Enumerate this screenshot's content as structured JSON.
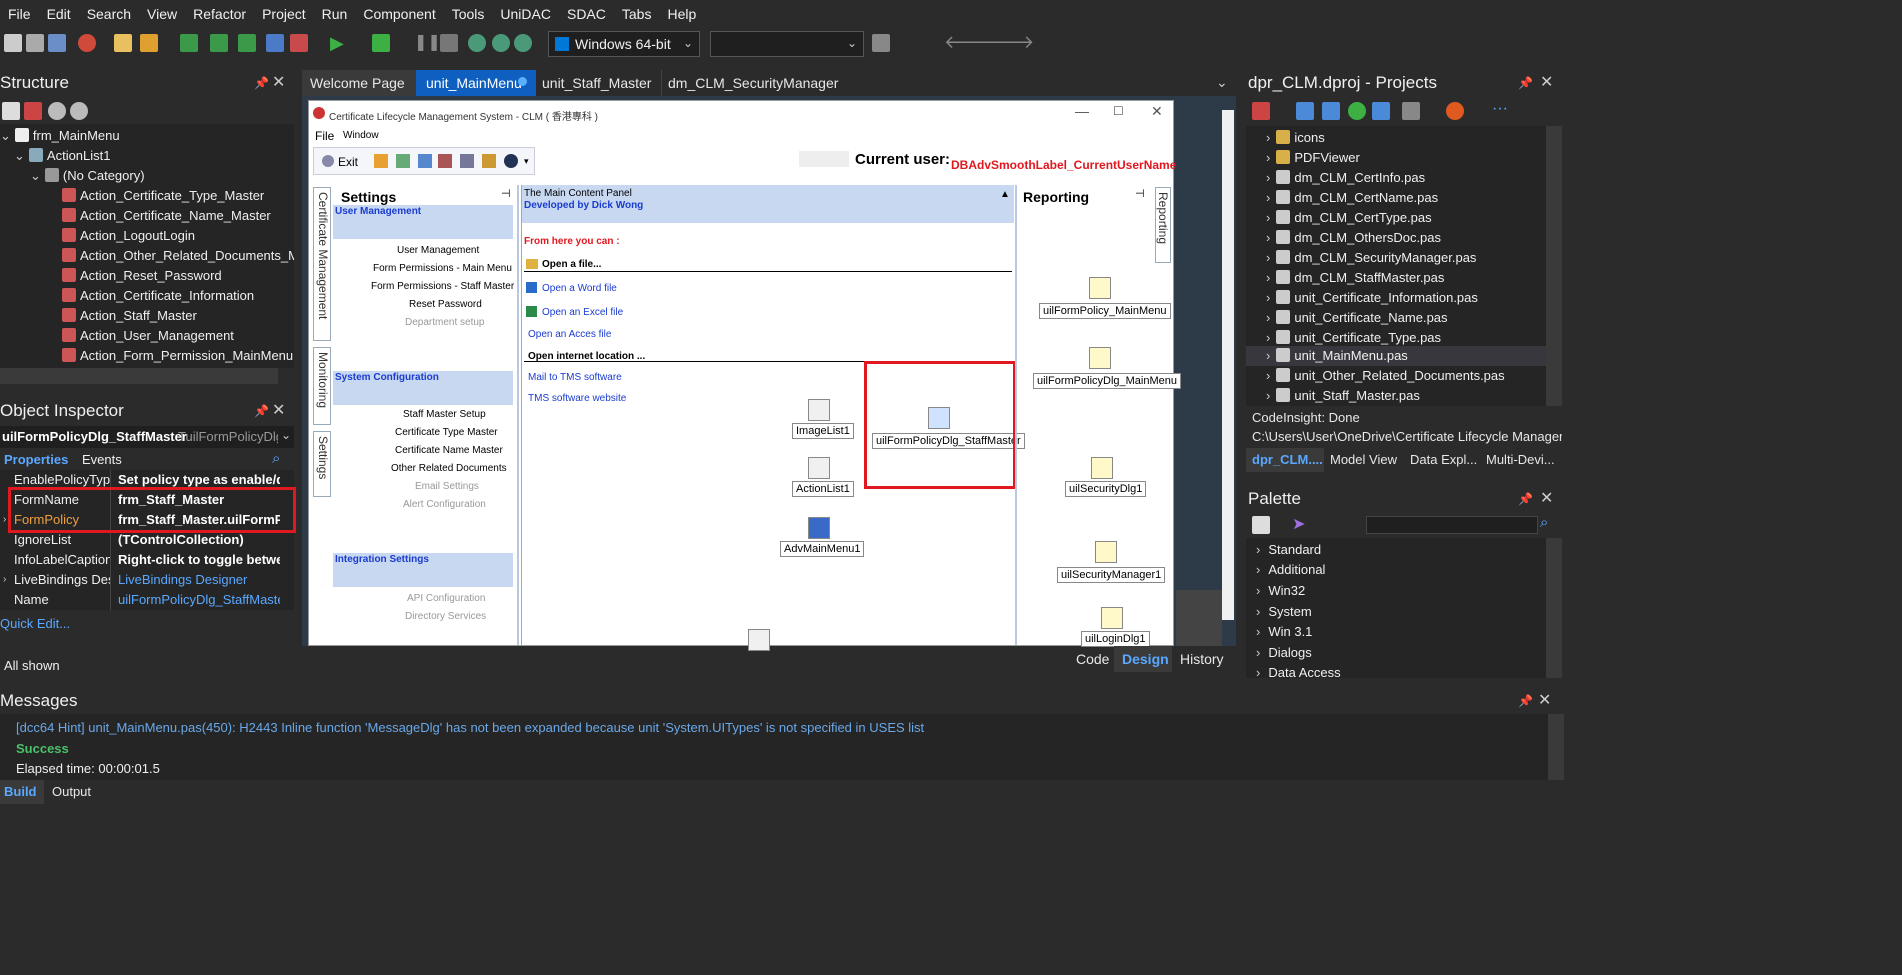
{
  "menu": [
    "File",
    "Edit",
    "Search",
    "View",
    "Refactor",
    "Project",
    "Run",
    "Component",
    "Tools",
    "UniDAC",
    "SDAC",
    "Tabs",
    "Help"
  ],
  "toolbar": {
    "platform": "Windows 64-bit",
    "config": ""
  },
  "structure": {
    "title": "Structure",
    "items": [
      "frm_MainMenu",
      "ActionList1",
      "(No Category)",
      "Action_Certificate_Type_Master",
      "Action_Certificate_Name_Master",
      "Action_LogoutLogin",
      "Action_Other_Related_Documents_M",
      "Action_Reset_Password",
      "Action_Certificate_Information",
      "Action_Staff_Master",
      "Action_User_Management",
      "Action_Form_Permission_MainMenu"
    ]
  },
  "inspector": {
    "title": "Object Inspector",
    "object": "uilFormPolicyDlg_StaffMaster",
    "object_type": "TuilFormPolicyDlg",
    "tabs": [
      "Properties",
      "Events"
    ],
    "rows": [
      {
        "k": "EnablePolicyType",
        "v": "Set policy type as enable/di:"
      },
      {
        "k": "FormName",
        "v": "frm_Staff_Master"
      },
      {
        "k": "FormPolicy",
        "v": "frm_Staff_Master.uilFormPc"
      },
      {
        "k": "IgnoreList",
        "v": "(TControlCollection)"
      },
      {
        "k": "InfoLabelCaption",
        "v": "Right-click to toggle betwee"
      },
      {
        "k": "LiveBindings Desi",
        "v": "LiveBindings Designer"
      },
      {
        "k": "Name",
        "v": "uilFormPolicyDlg_StaffMaster"
      }
    ],
    "quick_edit": "Quick Edit...",
    "all_shown": "All shown"
  },
  "editor_tabs": [
    "Welcome Page",
    "unit_MainMenu",
    "unit_Staff_Master",
    "dm_CLM_SecurityManager"
  ],
  "form": {
    "caption": "Certificate Lifecycle Management System - CLM ( 香港專科 )",
    "menu": [
      "File",
      "Window"
    ],
    "exit": "Exit",
    "current_user_label": "Current user:",
    "current_user_value": "DBAdvSmoothLabel_CurrentUserName",
    "settings_title": "Settings",
    "left_tabs": [
      "Certificate Management",
      "Monitoring",
      "Settings"
    ],
    "user_mgmt": {
      "title": "User Management",
      "items": [
        "User Management",
        "Form Permissions - Main Menu",
        "Form Permissions - Staff Master",
        "Reset Password",
        "Department setup"
      ]
    },
    "sys_config": {
      "title": "System Configuration",
      "items": [
        "Staff Master Setup",
        "Certificate Type Master",
        "Certificate Name Master",
        "Other Related Documents",
        "Email Settings",
        "Alert Configuration"
      ]
    },
    "integration": {
      "title": "Integration Settings",
      "items": [
        "API Configuration",
        "Directory Services"
      ]
    },
    "main_panel": {
      "title": "The Main Content Panel",
      "subtitle": "Developed by Dick Wong",
      "from_here": "From here you can :",
      "open_file": "Open a file...",
      "word": "Open a Word file",
      "excel": "Open an Excel file",
      "access": "Open an Acces file",
      "internet": "Open internet location ...",
      "mail": "Mail to TMS software",
      "website": "TMS software website"
    },
    "components": [
      "ImageList1",
      "ActionList1",
      "AdvMainMenu1",
      "uilFormPolicyDlg_StaffMaster"
    ],
    "reporting_title": "Reporting",
    "reporting_tab": "Reporting",
    "reporting_components": [
      "uilFormPolicy_MainMenu",
      "uilFormPolicyDlg_MainMenu",
      "uilSecurityDlg1",
      "uilSecurityManager1",
      "uilLoginDlg1"
    ]
  },
  "view_tabs": [
    "Code",
    "Design",
    "History"
  ],
  "projects": {
    "title": "dpr_CLM.dproj - Projects",
    "items": [
      "icons",
      "PDFViewer",
      "dm_CLM_CertInfo.pas",
      "dm_CLM_CertName.pas",
      "dm_CLM_CertType.pas",
      "dm_CLM_OthersDoc.pas",
      "dm_CLM_SecurityManager.pas",
      "dm_CLM_StaffMaster.pas",
      "unit_Certificate_Information.pas",
      "unit_Certificate_Name.pas",
      "unit_Certificate_Type.pas",
      "unit_MainMenu.pas",
      "unit_Other_Related_Documents.pas",
      "unit_Staff_Master.pas"
    ],
    "codeinsight": "CodeInsight: Done",
    "path": "C:\\Users\\User\\OneDrive\\Certificate Lifecycle Managem...",
    "tabs": [
      "dpr_CLM....",
      "Model View",
      "Data Expl...",
      "Multi-Devi..."
    ]
  },
  "palette": {
    "title": "Palette",
    "items": [
      "Standard",
      "Additional",
      "Win32",
      "System",
      "Win 3.1",
      "Dialogs",
      "Data Access"
    ]
  },
  "messages": {
    "title": "Messages",
    "hint": "[dcc64 Hint] unit_MainMenu.pas(450): H2443 Inline function 'MessageDlg' has not been expanded because unit 'System.UITypes' is not specified in USES list",
    "success": "Success",
    "elapsed": "Elapsed time: 00:00:01.5",
    "tabs": [
      "Build",
      "Output"
    ]
  },
  "colors": {
    "accent": "#0078d7",
    "highlight_box": "#e0181f",
    "selected_tab": "#0e5fc0"
  }
}
